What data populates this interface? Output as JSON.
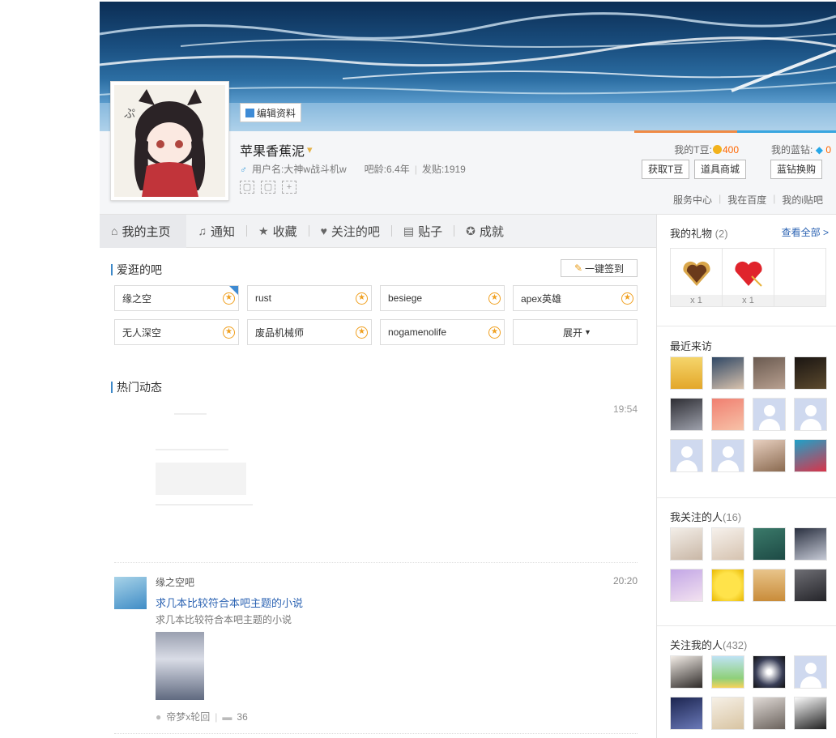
{
  "profile": {
    "edit_label": "编辑资料",
    "nickname": "苹果香蕉泥",
    "username": "用户名:大神w战斗机w",
    "bar_age": "吧龄:6.4年",
    "posts": "发贴:1919",
    "sex_icon": "male-icon",
    "tbean_label": "我的T豆:",
    "tbean_value": "400",
    "blue_label": "我的蓝钻:",
    "blue_value": "0",
    "get_tbean": "获取T豆",
    "prop_store": "道具商城",
    "blue_exchange": "蓝钻换购",
    "service_center": "服务中心",
    "my_baidu": "我在百度",
    "my_itieba": "我的i贴吧",
    "accent_orange": "#f08a45",
    "accent_blue": "#39a6e0"
  },
  "tabs": [
    {
      "label": "我的主页",
      "icon": "home-icon",
      "active": true
    },
    {
      "label": "通知",
      "icon": "bell-icon"
    },
    {
      "label": "收藏",
      "icon": "star-icon"
    },
    {
      "label": "关注的吧",
      "icon": "heart-icon"
    },
    {
      "label": "贴子",
      "icon": "document-icon"
    },
    {
      "label": "成就",
      "icon": "award-icon"
    }
  ],
  "favorite_bars": {
    "title": "爱逛的吧",
    "signin_label": "一键签到",
    "items": [
      "缘之空",
      "rust",
      "besiege",
      "apex英雄",
      "无人深空",
      "废品机械师",
      "nogamenolife"
    ],
    "expand_label": "展开"
  },
  "feed": {
    "title": "热门动态",
    "item1_time": "19:54",
    "item2": {
      "bar": "缘之空吧",
      "time": "20:20",
      "title": "求几本比较符合本吧主题的小说",
      "abstract": "求几本比较符合本吧主题的小说",
      "author": "帝梦x轮回",
      "replies": "36"
    }
  },
  "sidebar": {
    "gifts_title": "我的礼物",
    "gifts_count": "(2)",
    "see_all": "查看全部 >",
    "gifts": [
      {
        "count": "x 1"
      },
      {
        "count": "x 1"
      }
    ],
    "recent_title": "最近来访",
    "following_title": "我关注的人",
    "following_count": "(16)",
    "followers_title": "关注我的人",
    "followers_count": "(432)"
  }
}
